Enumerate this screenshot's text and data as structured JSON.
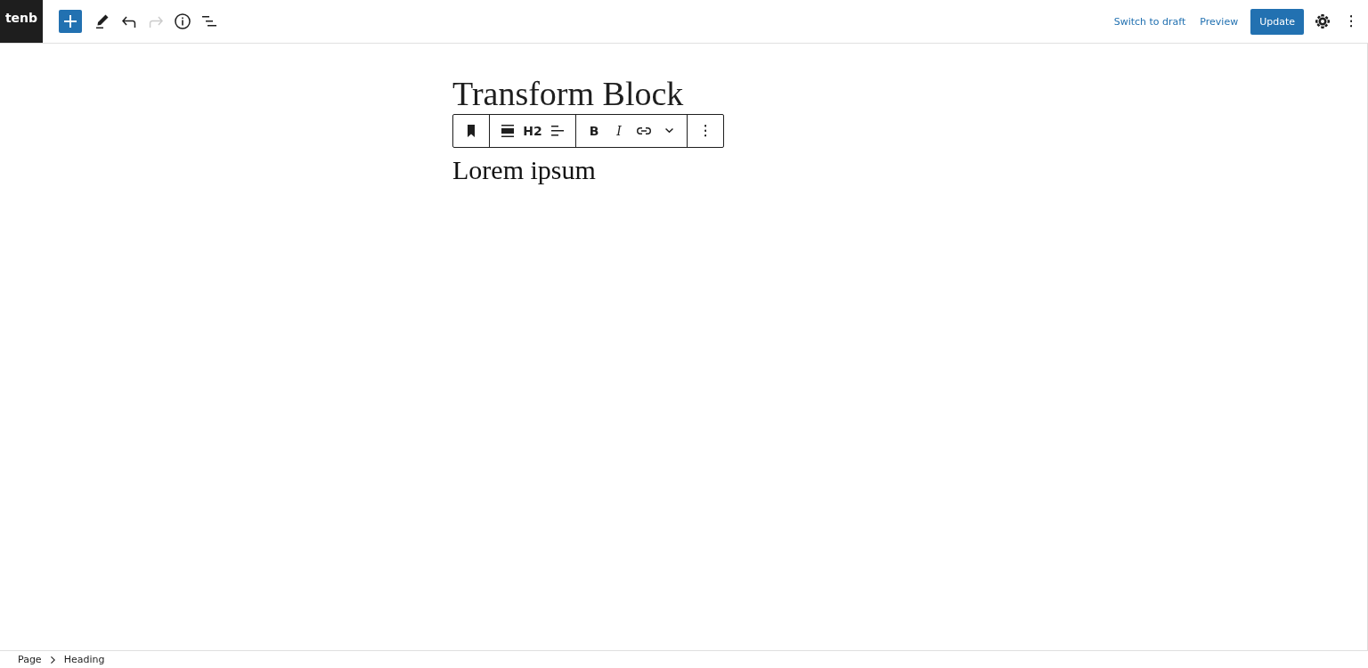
{
  "header": {
    "logo": {
      "text": "tenb"
    },
    "tools": [
      {
        "kind": "add",
        "disabled": false
      },
      {
        "kind": "edit",
        "disabled": false
      },
      {
        "kind": "undo",
        "disabled": false
      },
      {
        "kind": "redo",
        "disabled": true
      },
      {
        "kind": "info",
        "disabled": false
      },
      {
        "kind": "outline",
        "disabled": false
      }
    ],
    "actions": [
      {
        "kind": "link",
        "label": "Switch to draft"
      },
      {
        "kind": "link",
        "label": "Preview"
      },
      {
        "kind": "primary",
        "label": "Update"
      }
    ]
  },
  "document": {
    "title": "Transform Block",
    "heading": "Lorem ipsum"
  },
  "block_toolbar": {
    "groups": [
      [
        {
          "kind": "bookmark"
        }
      ],
      [
        {
          "kind": "align-wide"
        },
        {
          "kind": "text",
          "label": "H2"
        },
        {
          "kind": "align-text"
        }
      ],
      [
        {
          "kind": "bold",
          "label": "B"
        },
        {
          "kind": "italic",
          "label": "I"
        },
        {
          "kind": "link"
        },
        {
          "kind": "chevron"
        }
      ],
      [
        {
          "kind": "more"
        }
      ]
    ]
  },
  "breadcrumb": [
    "Page",
    "Heading"
  ]
}
